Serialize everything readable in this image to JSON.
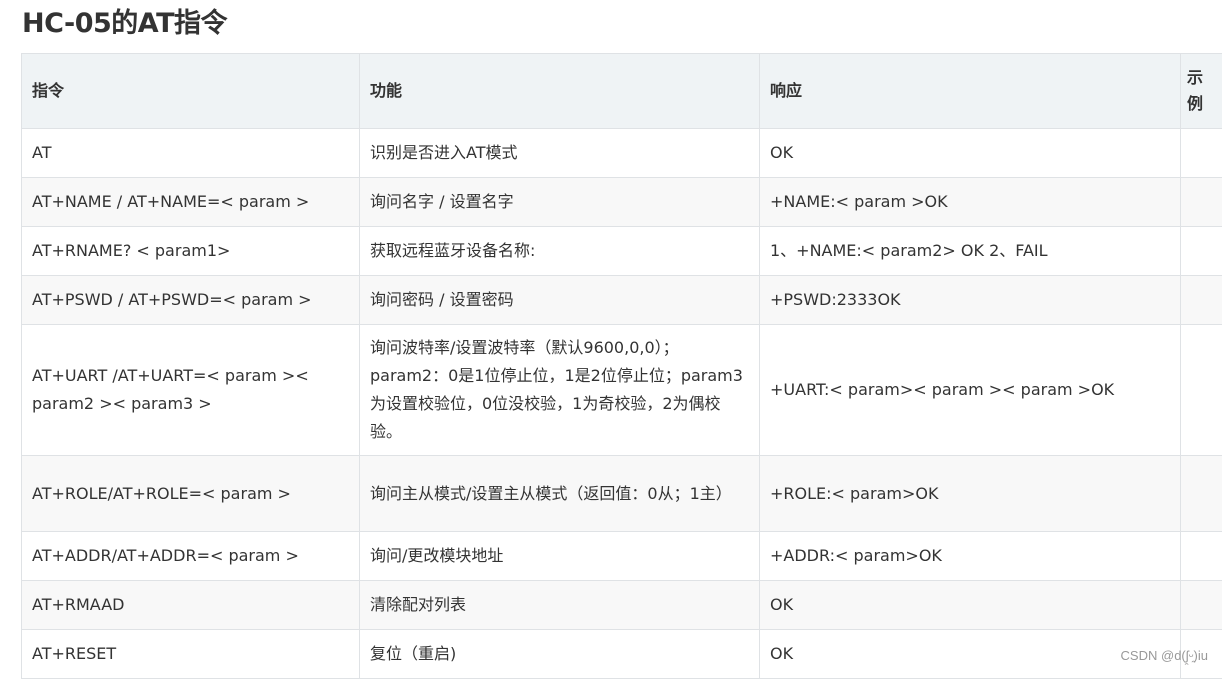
{
  "title": "HC-05的AT指令",
  "table": {
    "headers": [
      "指令",
      "功能",
      "响应",
      "示例"
    ],
    "rows": [
      [
        "AT",
        "识别是否进入AT模式",
        "OK",
        ""
      ],
      [
        "AT+NAME / AT+NAME=< param >",
        "询问名字 / 设置名字",
        "+NAME:< param >OK",
        ""
      ],
      [
        "AT+RNAME? < param1>",
        "获取远程蓝牙设备名称:",
        "1、+NAME:< param2> OK 2、FAIL",
        ""
      ],
      [
        "AT+PSWD / AT+PSWD=< param >",
        "询问密码 / 设置密码",
        "+PSWD:2333OK",
        ""
      ],
      [
        "AT+UART /AT+UART=< param >< param2 >< param3 >",
        "询问波特率/设置波特率（默认9600,0,0）；param2：0是1位停止位，1是2位停止位；param3为设置校验位，0位没校验，1为奇校验，2为偶校验。",
        "+UART:< param>< param >< param >OK",
        ""
      ],
      [
        "AT+ROLE/AT+ROLE=< param >",
        "询问主从模式/设置主从模式（返回值：0从；1主）",
        "+ROLE:< param>OK",
        ""
      ],
      [
        "AT+ADDR/AT+ADDR=< param >",
        "询问/更改模块地址",
        "+ADDR:< param>OK",
        ""
      ],
      [
        "AT+RMAAD",
        "清除配对列表",
        "OK",
        ""
      ],
      [
        "AT+RESET",
        "复位（重启)",
        "OK",
        ""
      ]
    ]
  },
  "watermark": "CSDN @d(ʃ̯ᵕ̯)iu"
}
